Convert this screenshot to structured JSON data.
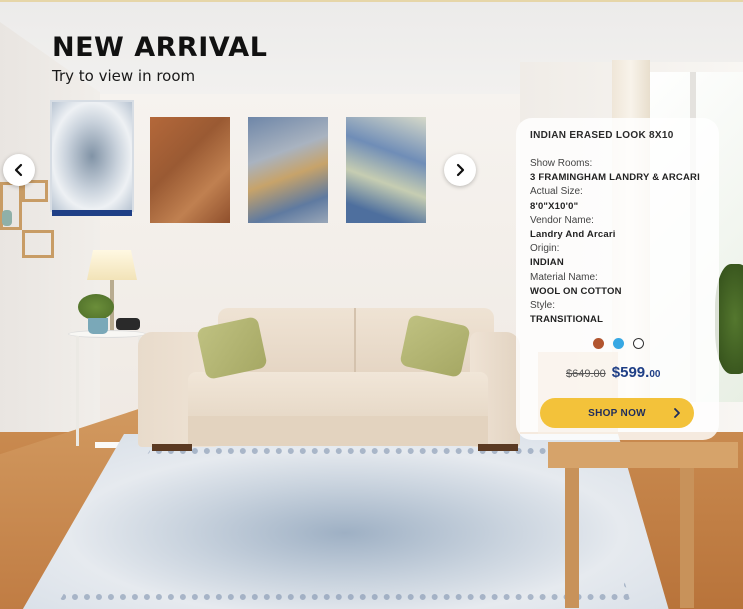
{
  "heading": {
    "title": "NEW ARRIVAL",
    "subtitle": "Try to view in room"
  },
  "carousel": {
    "prev_icon": "chevron-left-icon",
    "next_icon": "chevron-right-icon",
    "selected_index": 0,
    "item_count": 4
  },
  "product": {
    "name": "INDIAN ERASED LOOK 8X10",
    "fields": [
      {
        "label": "Show Rooms:",
        "value": "3 FRAMINGHAM LANDRY & ARCARI"
      },
      {
        "label": "Actual Size:",
        "value": "8'0\"X10'0\""
      },
      {
        "label": "Vendor Name:",
        "value": "Landry And Arcari"
      },
      {
        "label": "Origin:",
        "value": "INDIAN"
      },
      {
        "label": "Material Name:",
        "value": "WOOL ON COTTON"
      },
      {
        "label": "Style:",
        "value": "TRANSITIONAL"
      }
    ],
    "swatches": [
      "#b2552f",
      "#38a8e3",
      "#ffffff"
    ],
    "old_price": "$649.00",
    "price_main": "$599.",
    "price_cents": "00",
    "cta_label": "SHOP NOW"
  },
  "colors": {
    "accent": "#f3c23a",
    "price_blue": "#1f3f86"
  }
}
